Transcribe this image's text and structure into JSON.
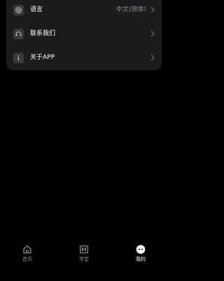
{
  "settings": {
    "items": [
      {
        "icon": "globe-icon",
        "label": "语言",
        "value": "中文(简体)"
      },
      {
        "icon": "headset-icon",
        "label": "联系我们",
        "value": ""
      },
      {
        "icon": "info-icon",
        "label": "关于APP",
        "value": ""
      }
    ]
  },
  "tabbar": {
    "tabs": [
      {
        "icon": "home-icon",
        "label": "首页",
        "active": false
      },
      {
        "icon": "book-icon",
        "label": "学堂",
        "active": false
      },
      {
        "icon": "profile-icon",
        "label": "我的",
        "active": true
      }
    ]
  },
  "colors": {
    "background": "#000000",
    "card": "#1c1c1e",
    "icon_bg": "#3a3a3c",
    "text": "#ffffff",
    "muted": "#8e8e93"
  }
}
